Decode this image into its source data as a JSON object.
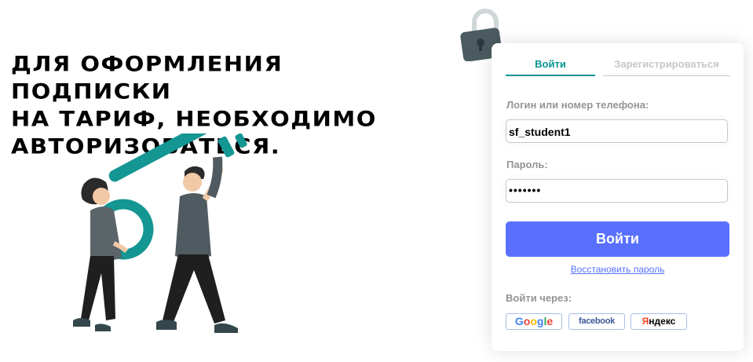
{
  "headline": {
    "line1": "ДЛЯ ОФОРМЛЕНИЯ ПОДПИСКИ",
    "line2": "НА ТАРИФ, НЕОБХОДИМО",
    "line3": "АВТОРИЗОВАТЬСЯ."
  },
  "tabs": {
    "login": "Войти",
    "register": "Зарегистрироваться",
    "active": "login"
  },
  "form": {
    "login_label": "Логин или номер телефона:",
    "login_value": "sf_student1",
    "password_label": "Пароль:",
    "password_value": "•••••••",
    "submit_label": "Войти",
    "restore_link": "Восстановить пароль"
  },
  "social": {
    "label": "Войти через:",
    "google_letters": [
      "G",
      "o",
      "o",
      "g",
      "l",
      "e"
    ],
    "facebook": "facebook",
    "yandex_first": "Я",
    "yandex_rest": "ндекс"
  },
  "icons": {
    "lock": "padlock-icon",
    "illustration": "people-carrying-key"
  },
  "colors": {
    "accent": "#029491",
    "button": "#5970ff",
    "muted": "#949494",
    "lock": "#4b5b61"
  }
}
